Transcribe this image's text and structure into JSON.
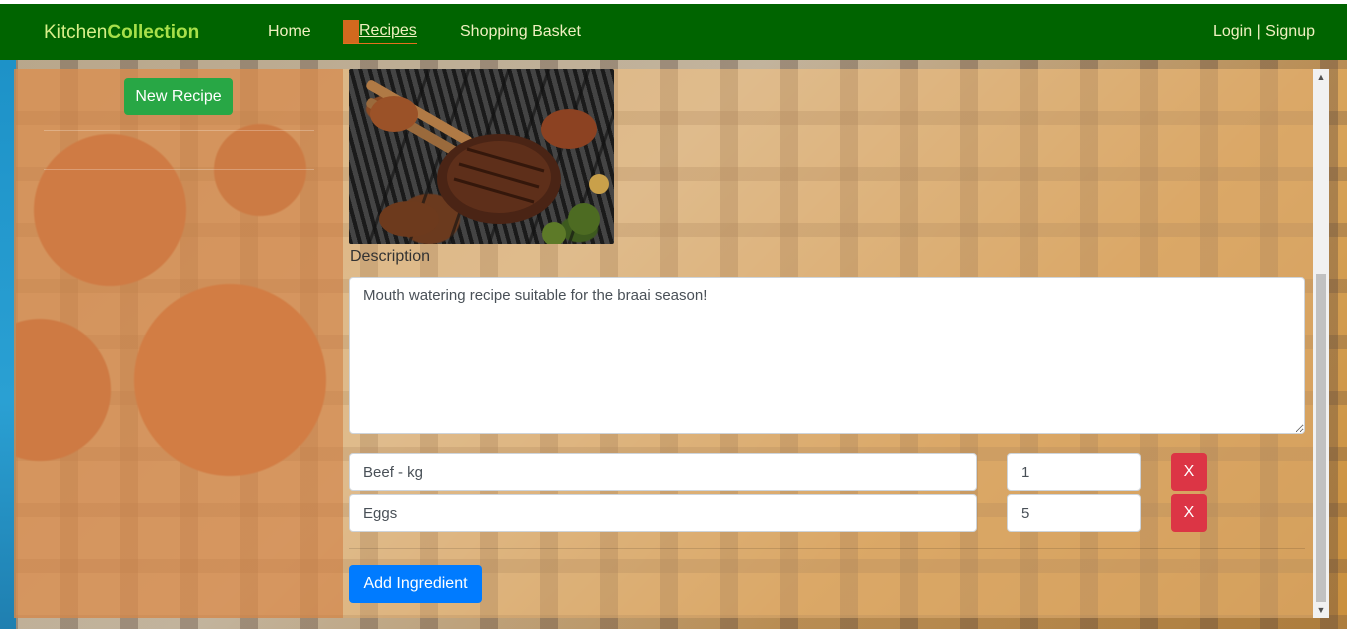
{
  "navbar": {
    "brand_light": "Kitchen",
    "brand_strong": "Collection",
    "links": {
      "home": "Home",
      "recipes": "Recipes",
      "basket": "Shopping Basket",
      "auth": "Login | Signup"
    },
    "active": "Recipes"
  },
  "sidebar": {
    "new_recipe_label": "New Recipe"
  },
  "recipe": {
    "image_icon": "grilled-steak-photo",
    "description_label": "Description",
    "description_value": "Mouth watering recipe suitable for the braai season!",
    "ingredients": [
      {
        "name": "Beef - kg",
        "amount": "1",
        "delete_label": "X"
      },
      {
        "name": "Eggs",
        "amount": "5",
        "delete_label": "X"
      }
    ],
    "add_ingredient_label": "Add Ingredient"
  },
  "colors": {
    "navbar": "#006400",
    "success": "#28a745",
    "danger": "#dc3545",
    "primary": "#007bff",
    "active_nav": "#d2691e"
  }
}
